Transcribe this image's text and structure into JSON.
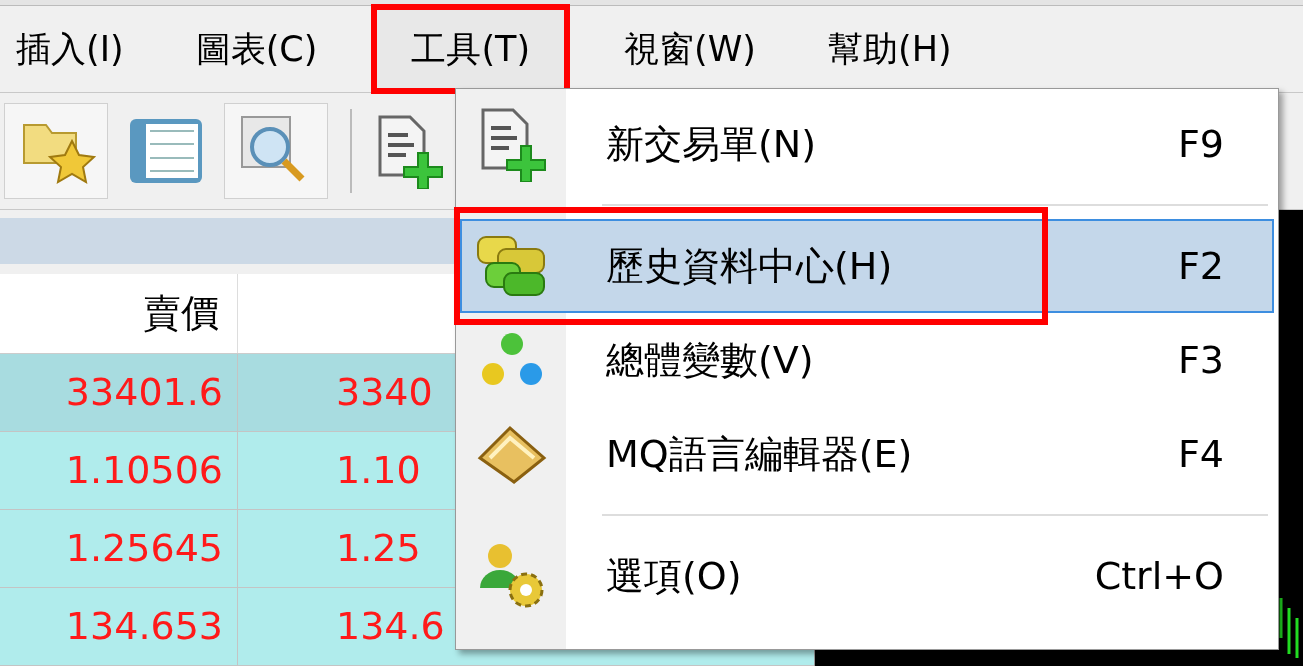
{
  "menubar": [
    {
      "label": "插入(I)",
      "marked": false
    },
    {
      "label": "圖表(C)",
      "marked": false
    },
    {
      "label": "工具(T)",
      "marked": true
    },
    {
      "label": "視窗(W)",
      "marked": false
    },
    {
      "label": "幫助(H)",
      "marked": false
    }
  ],
  "table": {
    "columns": [
      "賣價"
    ],
    "rows": [
      [
        "33401.6",
        "3340"
      ],
      [
        "1.10506",
        "1.10"
      ],
      [
        "1.25645",
        "1.25"
      ],
      [
        "134.653",
        "134.6"
      ]
    ]
  },
  "dropdown": [
    {
      "kind": "item",
      "label": "新交易單(N)",
      "shortcut": "F9",
      "selected": false,
      "marked": false
    },
    {
      "kind": "separator"
    },
    {
      "kind": "item",
      "label": "歷史資料中心(H)",
      "shortcut": "F2",
      "selected": true,
      "marked": true
    },
    {
      "kind": "item",
      "label": "總體變數(V)",
      "shortcut": "F3",
      "selected": false,
      "marked": false
    },
    {
      "kind": "item",
      "label": "MQ語言編輯器(E)",
      "shortcut": "F4",
      "selected": false,
      "marked": false
    },
    {
      "kind": "separator"
    },
    {
      "kind": "item",
      "label": "選項(O)",
      "shortcut": "Ctrl+O",
      "selected": false,
      "marked": false
    }
  ]
}
